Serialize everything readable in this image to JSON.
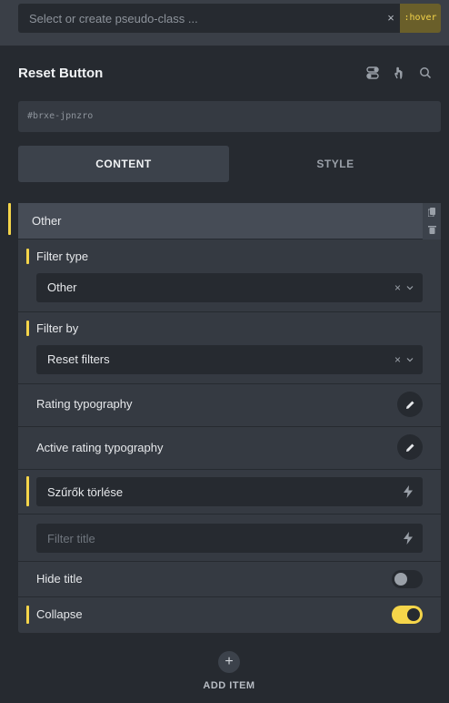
{
  "pseudo_class": {
    "placeholder": "Select or create pseudo-class ...",
    "clear_symbol": "×",
    "active_state": ":hover"
  },
  "panel": {
    "title": "Reset Button",
    "icons": [
      "toggle-icon",
      "pointer-icon",
      "search-icon"
    ],
    "element_id": "#brxe-jpnzro"
  },
  "tabs": [
    {
      "label": "CONTENT",
      "active": true
    },
    {
      "label": "STYLE",
      "active": false
    }
  ],
  "item": {
    "title": "Other",
    "filter_type": {
      "label": "Filter type",
      "value": "Other",
      "clear_symbol": "×"
    },
    "filter_by": {
      "label": "Filter by",
      "value": "Reset filters",
      "clear_symbol": "×"
    },
    "rating_typography": {
      "label": "Rating typography"
    },
    "active_rating_typography": {
      "label": "Active rating typography"
    },
    "button_text": {
      "value": "Szűrők törlése"
    },
    "filter_title": {
      "placeholder": "Filter title"
    },
    "hide_title": {
      "label": "Hide title",
      "enabled": false
    },
    "collapse": {
      "label": "Collapse",
      "enabled": true
    }
  },
  "add_item": {
    "symbol": "+",
    "label": "ADD ITEM"
  },
  "colors": {
    "accent": "#f5d54a",
    "background": "#262a30",
    "panel": "#353a42"
  }
}
